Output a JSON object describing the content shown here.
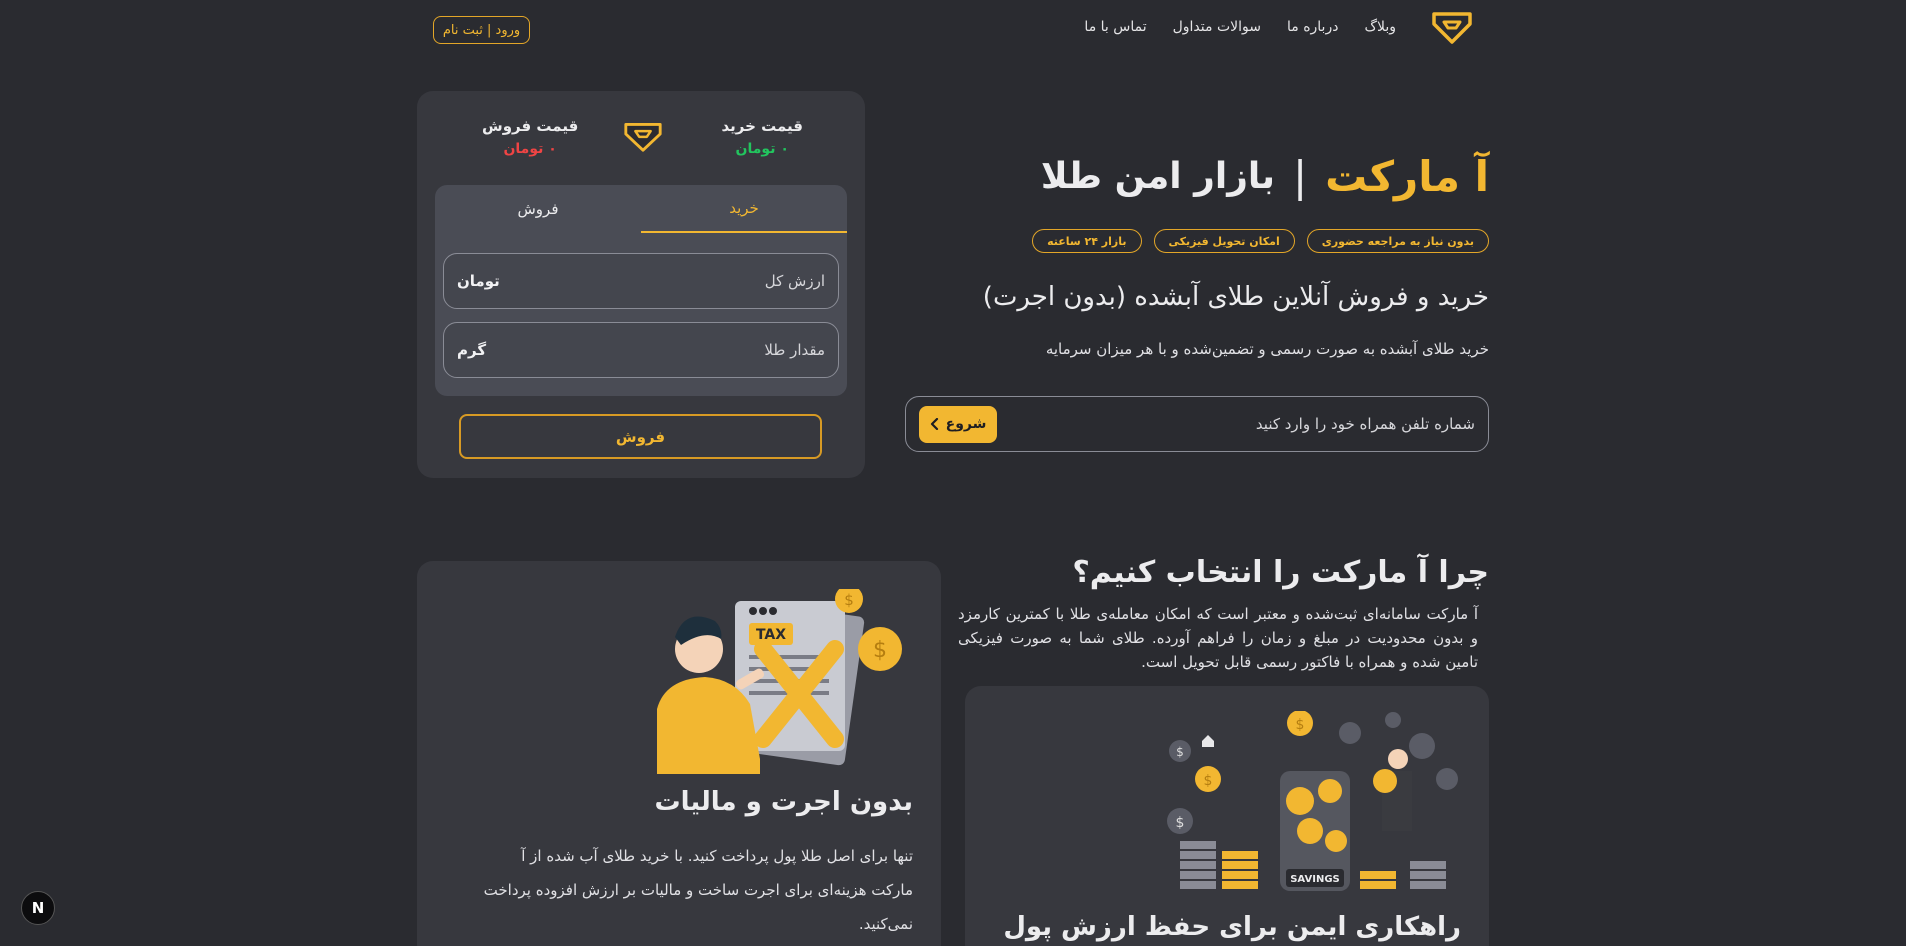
{
  "header": {
    "nav": [
      "وبلاگ",
      "درباره ما",
      "سوالات متداول",
      "تماس با ما"
    ],
    "login_label": "ورود | ثبت نام"
  },
  "trade": {
    "buy_price_label": "قیمت خرید",
    "buy_price_value": "۰ تومان",
    "sell_price_label": "قیمت فروش",
    "sell_price_value": "۰ تومان",
    "tabs": {
      "buy": "خرید",
      "sell": "فروش"
    },
    "value_field": {
      "placeholder": "ارزش کل",
      "unit": "تومان"
    },
    "gold_field": {
      "placeholder": "مقدار طلا",
      "unit": "گرم"
    },
    "submit_label": "فروش"
  },
  "hero": {
    "brand": "آ مارکت",
    "separator": "|",
    "slogan": "بازار امن طلا",
    "badges": [
      "بدون نیاز به مراجعه حضوری",
      "امکان تحویل فیزیکی",
      "بازار ۲۴ ساعته"
    ],
    "subtitle": "خرید و فروش آنلاین طلای آبشده (بدون اجرت)",
    "description": "خرید طلای آبشده به صورت رسمی و تضمین‌شده و با هر میزان سرمایه",
    "phone_placeholder": "شماره تلفن همراه خود را وارد کنید",
    "start_label": "شروع"
  },
  "why": {
    "title": "چرا آ مارکت را انتخاب کنیم؟",
    "text": "آ مارکت سامانه‌ای ثبت‌شده و معتبر است که امکان معامله‌ی طلا با کمترین کارمزد و بدون محدودیت در مبلغ و زمان را فراهم آورده. طلای شما به صورت فیزیکی تامین شده و همراه با فاکتور رسمی قابل تحویل است."
  },
  "features": {
    "no_fee": {
      "title": "بدون اجرت و مالیات",
      "text": "تنها برای اصل طلا پول پرداخت کنید. با خرید طلای آب شده از آ مارکت هزینه‌ای برای اجرت ساخت و مالیات بر ارزش افزوده پرداخت نمی‌کنید.",
      "tax_label": "TAX"
    },
    "safe": {
      "title": "راهکاری ایمن برای حفظ ارزش پول",
      "savings_label": "SAVINGS"
    }
  },
  "dev_badge": "N",
  "colors": {
    "accent": "#f2b731",
    "bg": "#2a2b30",
    "card": "#37383e",
    "up": "#22c55e",
    "down": "#ef4444"
  }
}
